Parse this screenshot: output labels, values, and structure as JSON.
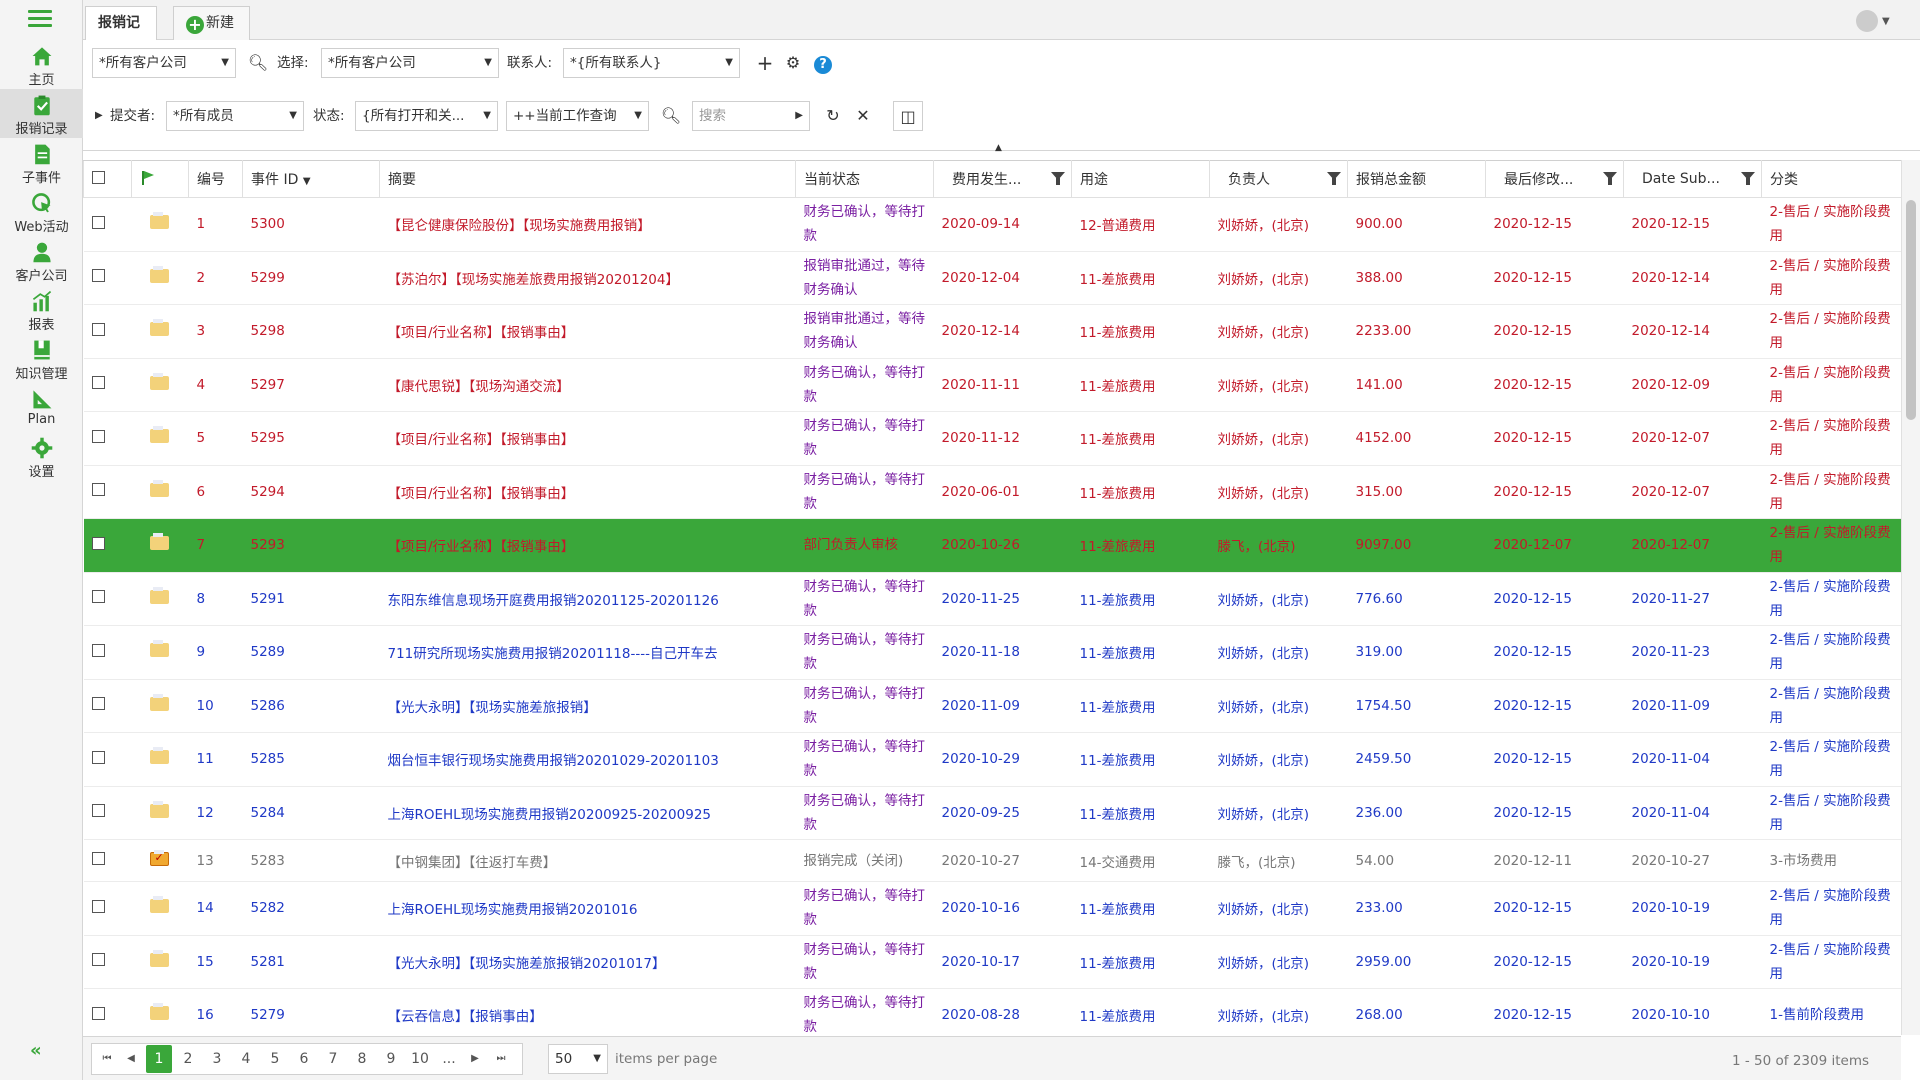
{
  "sidebar": {
    "items": [
      {
        "label": "主页",
        "icon": "home-icon"
      },
      {
        "label": "报销记录",
        "icon": "clipboard-check-icon"
      },
      {
        "label": "子事件",
        "icon": "document-icon"
      },
      {
        "label": "Web活动",
        "icon": "cursor-click-icon"
      },
      {
        "label": "客户公司",
        "icon": "person-icon"
      },
      {
        "label": "报表",
        "icon": "bar-chart-icon"
      },
      {
        "label": "知识管理",
        "icon": "book-icon"
      },
      {
        "label": "Plan",
        "icon": "triangle-ruler-icon"
      },
      {
        "label": "设置",
        "icon": "gear-icon"
      }
    ],
    "collapse": "«"
  },
  "tabs": {
    "active": "报销记录",
    "new": "新建"
  },
  "filters": {
    "company1": "*所有客户公司",
    "select_label": "选择:",
    "company2": "*所有客户公司",
    "contact_label": "联系人:",
    "contact": "*{所有联系人}",
    "submitter_label": "提交者:",
    "submitter": "*所有成员",
    "status_label": "状态:",
    "status": "{所有打开和关...",
    "query": "++当前工作查询",
    "search_placeholder": "搜索"
  },
  "columns": [
    "编号",
    "事件 ID",
    "摘要",
    "当前状态",
    "费用发生...",
    "用途",
    "负责人",
    "报销总金额",
    "最后修改...",
    "Date Sub...",
    "分类"
  ],
  "rows": [
    {
      "n": "1",
      "id": "5300",
      "sum": "【昆仑健康保险股份】【现场实施费用报销】",
      "st": "财务已确认，等待打款",
      "d1": "2020-09-14",
      "use": "12-普通费用",
      "owner": "刘娇娇，(北京)",
      "amt": "900.00",
      "mod": "2020-12-15",
      "sub": "2020-12-15",
      "cat": "2-售后 / 实施阶段费用",
      "cls": "red"
    },
    {
      "n": "2",
      "id": "5299",
      "sum": "【苏泊尔】【现场实施差旅费用报销20201204】",
      "st": "报销审批通过，等待财务确认",
      "d1": "2020-12-04",
      "use": "11-差旅费用",
      "owner": "刘娇娇，(北京)",
      "amt": "388.00",
      "mod": "2020-12-15",
      "sub": "2020-12-14",
      "cat": "2-售后 / 实施阶段费用",
      "cls": "red"
    },
    {
      "n": "3",
      "id": "5298",
      "sum": "【项目/行业名称】【报销事由】",
      "st": "报销审批通过，等待财务确认",
      "d1": "2020-12-14",
      "use": "11-差旅费用",
      "owner": "刘娇娇，(北京)",
      "amt": "2233.00",
      "mod": "2020-12-15",
      "sub": "2020-12-14",
      "cat": "2-售后 / 实施阶段费用",
      "cls": "red"
    },
    {
      "n": "4",
      "id": "5297",
      "sum": "【康代思锐】【现场沟通交流】",
      "st": "财务已确认，等待打款",
      "d1": "2020-11-11",
      "use": "11-差旅费用",
      "owner": "刘娇娇，(北京)",
      "amt": "141.00",
      "mod": "2020-12-15",
      "sub": "2020-12-09",
      "cat": "2-售后 / 实施阶段费用",
      "cls": "red"
    },
    {
      "n": "5",
      "id": "5295",
      "sum": "【项目/行业名称】【报销事由】",
      "st": "财务已确认，等待打款",
      "d1": "2020-11-12",
      "use": "11-差旅费用",
      "owner": "刘娇娇，(北京)",
      "amt": "4152.00",
      "mod": "2020-12-15",
      "sub": "2020-12-07",
      "cat": "2-售后 / 实施阶段费用",
      "cls": "red"
    },
    {
      "n": "6",
      "id": "5294",
      "sum": "【项目/行业名称】【报销事由】",
      "st": "财务已确认，等待打款",
      "d1": "2020-06-01",
      "use": "11-差旅费用",
      "owner": "刘娇娇，(北京)",
      "amt": "315.00",
      "mod": "2020-12-15",
      "sub": "2020-12-07",
      "cat": "2-售后 / 实施阶段费用",
      "cls": "red"
    },
    {
      "n": "7",
      "id": "5293",
      "sum": "【项目/行业名称】【报销事由】",
      "st": "部门负责人审核",
      "d1": "2020-10-26",
      "use": "11-差旅费用",
      "owner": "滕飞，(北京)",
      "amt": "9097.00",
      "mod": "2020-12-07",
      "sub": "2020-12-07",
      "cat": "2-售后 / 实施阶段费用",
      "cls": "sel"
    },
    {
      "n": "8",
      "id": "5291",
      "sum": "东阳东维信息现场开庭费用报销20201125-20201126",
      "st": "财务已确认，等待打款",
      "d1": "2020-11-25",
      "use": "11-差旅费用",
      "owner": "刘娇娇，(北京)",
      "amt": "776.60",
      "mod": "2020-12-15",
      "sub": "2020-11-27",
      "cat": "2-售后 / 实施阶段费用",
      "cls": ""
    },
    {
      "n": "9",
      "id": "5289",
      "sum": "711研究所现场实施费用报销20201118----自己开车去",
      "st": "财务已确认，等待打款",
      "d1": "2020-11-18",
      "use": "11-差旅费用",
      "owner": "刘娇娇，(北京)",
      "amt": "319.00",
      "mod": "2020-12-15",
      "sub": "2020-11-23",
      "cat": "2-售后 / 实施阶段费用",
      "cls": ""
    },
    {
      "n": "10",
      "id": "5286",
      "sum": "【光大永明】【现场实施差旅报销】",
      "st": "财务已确认，等待打款",
      "d1": "2020-11-09",
      "use": "11-差旅费用",
      "owner": "刘娇娇，(北京)",
      "amt": "1754.50",
      "mod": "2020-12-15",
      "sub": "2020-11-09",
      "cat": "2-售后 / 实施阶段费用",
      "cls": ""
    },
    {
      "n": "11",
      "id": "5285",
      "sum": "烟台恒丰银行现场实施费用报销20201029-20201103",
      "st": "财务已确认，等待打款",
      "d1": "2020-10-29",
      "use": "11-差旅费用",
      "owner": "刘娇娇，(北京)",
      "amt": "2459.50",
      "mod": "2020-12-15",
      "sub": "2020-11-04",
      "cat": "2-售后 / 实施阶段费用",
      "cls": ""
    },
    {
      "n": "12",
      "id": "5284",
      "sum": "上海ROEHL现场实施费用报销20200925-20200925",
      "st": "财务已确认，等待打款",
      "d1": "2020-09-25",
      "use": "11-差旅费用",
      "owner": "刘娇娇，(北京)",
      "amt": "236.00",
      "mod": "2020-12-15",
      "sub": "2020-11-04",
      "cat": "2-售后 / 实施阶段费用",
      "cls": ""
    },
    {
      "n": "13",
      "id": "5283",
      "sum": "【中钢集团】【往返打车费】",
      "st": "报销完成（关闭)",
      "d1": "2020-10-27",
      "use": "14-交通费用",
      "owner": "滕飞，(北京)",
      "amt": "54.00",
      "mod": "2020-12-11",
      "sub": "2020-10-27",
      "cat": "3-市场费用",
      "cls": "closed"
    },
    {
      "n": "14",
      "id": "5282",
      "sum": "上海ROEHL现场实施费用报销20201016",
      "st": "财务已确认，等待打款",
      "d1": "2020-10-16",
      "use": "11-差旅费用",
      "owner": "刘娇娇，(北京)",
      "amt": "233.00",
      "mod": "2020-12-15",
      "sub": "2020-10-19",
      "cat": "2-售后 / 实施阶段费用",
      "cls": ""
    },
    {
      "n": "15",
      "id": "5281",
      "sum": "【光大永明】【现场实施差旅报销20201017】",
      "st": "财务已确认，等待打款",
      "d1": "2020-10-17",
      "use": "11-差旅费用",
      "owner": "刘娇娇，(北京)",
      "amt": "2959.00",
      "mod": "2020-12-15",
      "sub": "2020-10-19",
      "cat": "2-售后 / 实施阶段费用",
      "cls": ""
    },
    {
      "n": "16",
      "id": "5279",
      "sum": "【云吞信息】【报销事由】",
      "st": "财务已确认，等待打款",
      "d1": "2020-08-28",
      "use": "11-差旅费用",
      "owner": "刘娇娇，(北京)",
      "amt": "268.00",
      "mod": "2020-12-15",
      "sub": "2020-10-10",
      "cat": "1-售前阶段费用",
      "cls": ""
    }
  ],
  "pager": {
    "pages": [
      "1",
      "2",
      "3",
      "4",
      "5",
      "6",
      "7",
      "8",
      "9",
      "10",
      "..."
    ],
    "page_size": "50",
    "per_page_label": "items per page",
    "summary": "1 - 50 of 2309 items"
  },
  "colors": {
    "accent": "#3aa73a",
    "link": "#1f39c6",
    "red_text": "#c21a2a",
    "status_purple": "#7a1fa2"
  }
}
